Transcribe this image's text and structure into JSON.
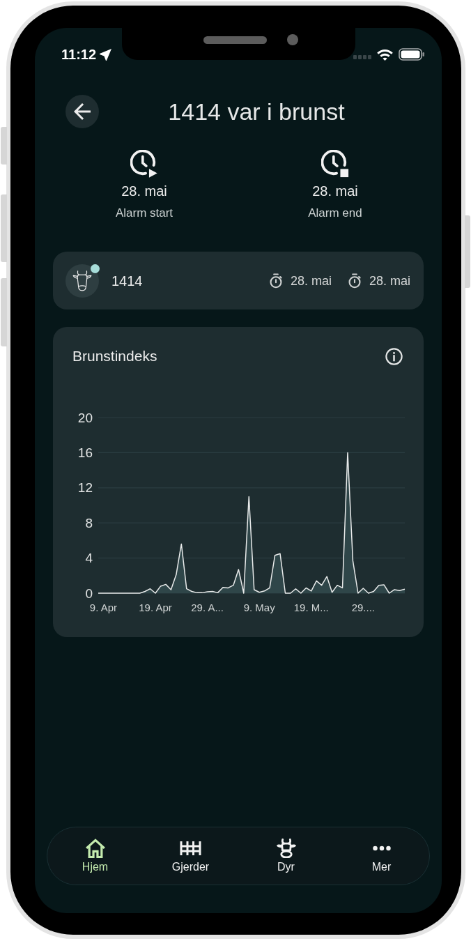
{
  "status_bar": {
    "time": "11:12"
  },
  "header": {
    "title": "1414 var i brunst"
  },
  "alarm": [
    {
      "kind": "start",
      "date": "28. mai",
      "label": "Alarm start"
    },
    {
      "kind": "end",
      "date": "28. mai",
      "label": "Alarm end"
    }
  ],
  "animal": {
    "id": "1414",
    "color": "#a6dcd8",
    "times": [
      "28. mai",
      "28. mai"
    ]
  },
  "chart_card": {
    "title": "Brunstindeks",
    "chart_data": {
      "type": "area",
      "categories": [
        null,
        "9. Apr",
        null,
        null,
        null,
        null,
        null,
        null,
        null,
        null,
        null,
        "19. Apr",
        null,
        null,
        null,
        null,
        null,
        null,
        null,
        null,
        null,
        "29. A...",
        null,
        null,
        null,
        null,
        null,
        null,
        null,
        null,
        null,
        "9. May",
        null,
        null,
        null,
        null,
        null,
        null,
        null,
        null,
        null,
        "19. M...",
        null,
        null,
        null,
        null,
        null,
        null,
        null,
        null,
        null,
        "29....",
        null,
        null,
        null,
        null,
        null,
        null,
        null,
        null
      ],
      "values": [
        0,
        0,
        0,
        0,
        0,
        0,
        0,
        0,
        0,
        0.2,
        0.5,
        0,
        0.8,
        1.0,
        0.4,
        2.1,
        5.6,
        0.5,
        0.2,
        0.05,
        0.05,
        0.15,
        0.2,
        0.05,
        0.65,
        0.6,
        0.9,
        2.7,
        0,
        11.0,
        0.4,
        0.1,
        0.25,
        0.6,
        4.3,
        4.5,
        0,
        0,
        0.5,
        0,
        0.6,
        0.25,
        1.4,
        0.9,
        1.9,
        0.1,
        0.9,
        0.6,
        16.0,
        3.7,
        0,
        0.55,
        0,
        0.2,
        0.9,
        0.95,
        0,
        0.4,
        0.3,
        0.45
      ],
      "ylim": [
        0,
        20
      ],
      "yticks": [
        0,
        4,
        8,
        12,
        16,
        20
      ],
      "grid": true
    }
  },
  "nav": {
    "items": [
      {
        "kind": "home",
        "label": "Hjem",
        "selected": true
      },
      {
        "kind": "fence",
        "label": "Gjerder",
        "selected": false
      },
      {
        "kind": "cow",
        "label": "Dyr",
        "selected": false
      },
      {
        "kind": "more",
        "label": "Mer",
        "selected": false
      }
    ]
  }
}
